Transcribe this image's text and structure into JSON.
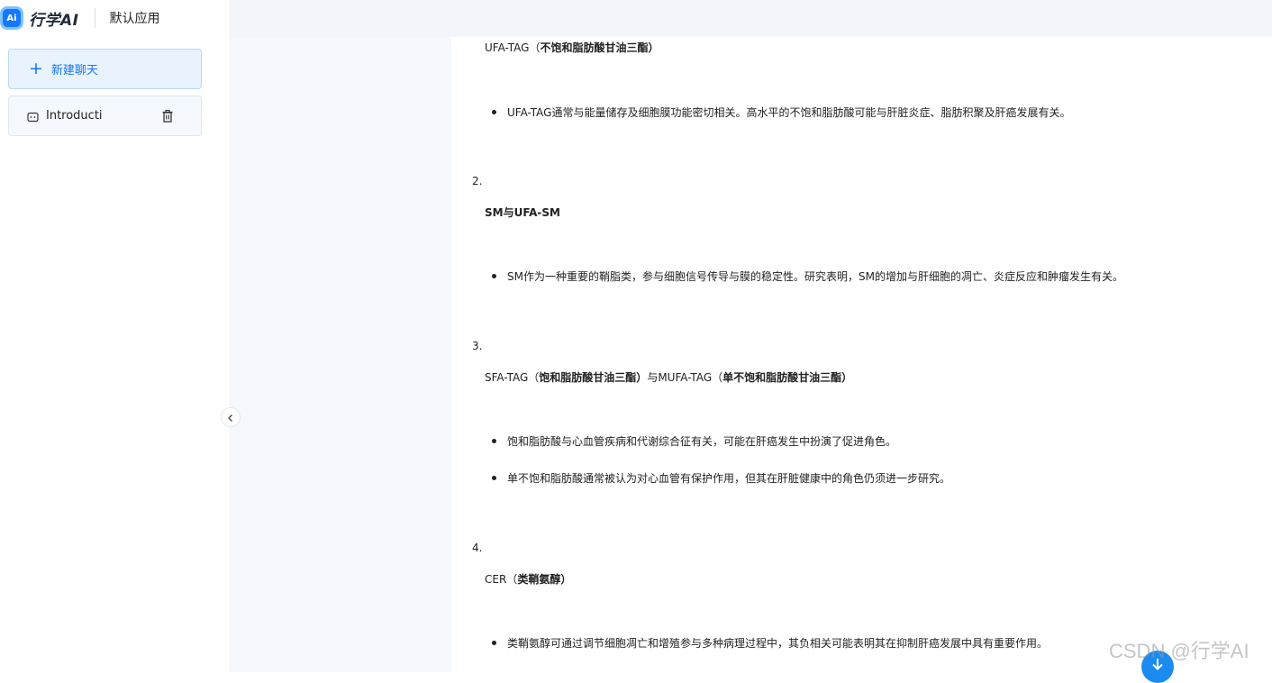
{
  "brand": {
    "logo_badge": "Ai",
    "logo_text": "行学AI",
    "app_name": "默认应用"
  },
  "sidebar": {
    "new_chat_label": "新建聊天",
    "conversations": [
      {
        "title": "Introducti",
        "icon": "chat-bubble-icon",
        "action_icon": "trash-icon"
      }
    ]
  },
  "content": {
    "section1": {
      "heading_plain": "UFA-TAG（",
      "heading_bold": "不饱和脂肪酸甘油三酯）",
      "bullets": [
        "UFA-TAG通常与能量储存及细胞膜功能密切相关。高水平的不饱和脂肪酸可能与肝脏炎症、脂肪积聚及肝癌发展有关。"
      ]
    },
    "section2": {
      "number": "2.",
      "heading_plain": "SM与UFA-SM",
      "bullets": [
        "SM作为一种重要的鞘脂类，参与细胞信号传导与膜的稳定性。研究表明，SM的增加与肝细胞的凋亡、炎症反应和肿瘤发生有关。"
      ]
    },
    "section3": {
      "number": "3.",
      "heading_plain_a": "SFA-TAG（",
      "heading_bold_a": "饱和脂肪酸甘油三酯）",
      "heading_plain_b": "与MUFA-TAG（",
      "heading_bold_b": "单不饱和脂肪酸甘油三酯）",
      "bullets": [
        "饱和脂肪酸与心血管疾病和代谢综合征有关，可能在肝癌发生中扮演了促进角色。",
        "单不饱和脂肪酸通常被认为对心血管有保护作用，但其在肝脏健康中的角色仍须进一步研究。"
      ]
    },
    "section4": {
      "number": "4.",
      "heading_plain": "CER（",
      "heading_bold": "类鞘氨醇）",
      "bullets": [
        "类鞘氨醇可通过调节细胞凋亡和增殖参与多种病理过程中，其负相关可能表明其在抑制肝癌发展中具有重要作用。"
      ]
    }
  },
  "watermark": "CSDN @行学AI",
  "colors": {
    "accent": "#1677ff",
    "scroll_button": "#1a8cf0",
    "main_bg": "#f5f8fc"
  }
}
